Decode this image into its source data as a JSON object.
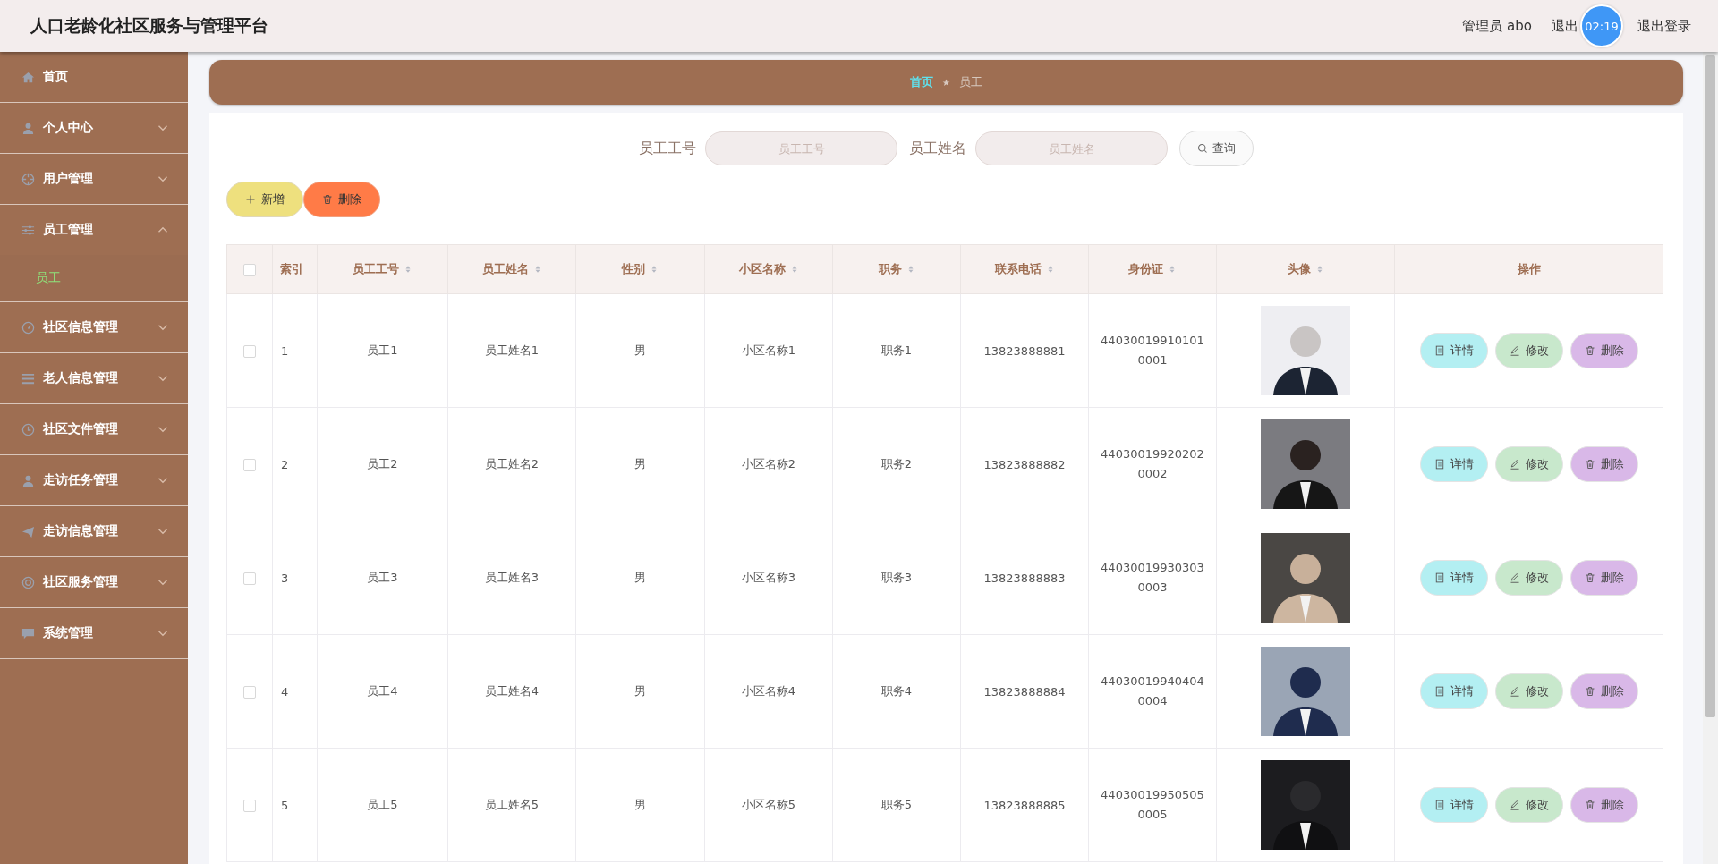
{
  "header": {
    "title": "人口老龄化社区服务与管理平台",
    "user": "管理员 abo",
    "front_link": "退出",
    "timer": "02:19",
    "logout": "退出登录"
  },
  "sidebar": {
    "items": [
      {
        "kind": "link",
        "label": "首页"
      },
      {
        "kind": "menu",
        "label": "个人中心",
        "expanded": false
      },
      {
        "kind": "menu",
        "label": "用户管理",
        "expanded": false
      },
      {
        "kind": "menu",
        "label": "员工管理",
        "expanded": true,
        "children": [
          {
            "label": "员工",
            "selected": true
          }
        ]
      },
      {
        "kind": "menu",
        "label": "社区信息管理",
        "expanded": false
      },
      {
        "kind": "menu",
        "label": "老人信息管理",
        "expanded": false
      },
      {
        "kind": "menu",
        "label": "社区文件管理",
        "expanded": false
      },
      {
        "kind": "menu",
        "label": "走访任务管理",
        "expanded": false
      },
      {
        "kind": "menu",
        "label": "走访信息管理",
        "expanded": false
      },
      {
        "kind": "menu",
        "label": "社区服务管理",
        "expanded": false
      },
      {
        "kind": "menu",
        "label": "系统管理",
        "expanded": false
      }
    ]
  },
  "breadcrumb": [
    "首页",
    "员工"
  ],
  "search": {
    "fields": [
      {
        "label": "员工工号",
        "placeholder": "员工工号"
      },
      {
        "label": "员工姓名",
        "placeholder": "员工姓名"
      }
    ],
    "button": "查询"
  },
  "actions": {
    "add": "新增",
    "delete": "删除"
  },
  "table": {
    "select_all_checked": false,
    "columns": [
      {
        "label": "索引",
        "sortable": false
      },
      {
        "label": "员工工号",
        "sortable": true
      },
      {
        "label": "员工姓名",
        "sortable": true
      },
      {
        "label": "性别",
        "sortable": true
      },
      {
        "label": "小区名称",
        "sortable": true
      },
      {
        "label": "职务",
        "sortable": true
      },
      {
        "label": "联系电话",
        "sortable": true
      },
      {
        "label": "身份证",
        "sortable": true
      },
      {
        "label": "头像",
        "sortable": true
      },
      {
        "label": "操作",
        "sortable": false
      }
    ],
    "rows": [
      {
        "checked": false,
        "cells": [
          "1",
          "员工1",
          "员工姓名1",
          "男",
          "小区名称1",
          "职务1",
          "13823888881",
          "440300199101010001"
        ],
        "buttons": [
          "详情",
          "修改",
          "删除"
        ]
      },
      {
        "checked": false,
        "cells": [
          "2",
          "员工2",
          "员工姓名2",
          "男",
          "小区名称2",
          "职务2",
          "13823888882",
          "440300199202020002"
        ],
        "buttons": [
          "详情",
          "修改",
          "删除"
        ]
      },
      {
        "checked": false,
        "cells": [
          "3",
          "员工3",
          "员工姓名3",
          "男",
          "小区名称3",
          "职务3",
          "13823888883",
          "440300199303030003"
        ],
        "buttons": [
          "详情",
          "修改",
          "删除"
        ]
      },
      {
        "checked": false,
        "cells": [
          "4",
          "员工4",
          "员工姓名4",
          "男",
          "小区名称4",
          "职务4",
          "13823888884",
          "440300199404040004"
        ],
        "buttons": [
          "详情",
          "修改",
          "删除"
        ]
      },
      {
        "checked": false,
        "cells": [
          "5",
          "员工5",
          "员工姓名5",
          "男",
          "小区名称5",
          "职务5",
          "13823888885",
          "440300199505050005"
        ],
        "buttons": [
          "详情",
          "修改",
          "删除"
        ]
      }
    ]
  }
}
